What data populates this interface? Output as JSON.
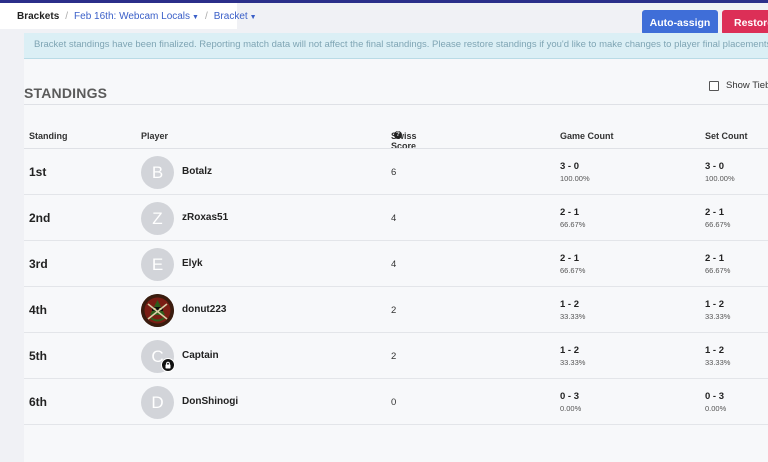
{
  "breadcrumb": {
    "root": "Brackets",
    "event": "Feb 16th: Webcam Locals",
    "view": "Bracket"
  },
  "actions": {
    "auto_assign": "Auto-assign",
    "restore": "Restore"
  },
  "banner": {
    "text": "Bracket standings have been finalized. Reporting match data will not affect the final standings. Please restore standings if you'd like to make changes to player final placements."
  },
  "standings": {
    "title": "STANDINGS",
    "show_tiebreakers_label": "Show Tieb",
    "columns": {
      "standing": "Standing",
      "player": "Player",
      "swiss_score": "Swiss Score",
      "game_count": "Game Count",
      "set_count": "Set Count"
    },
    "rows": [
      {
        "place": "1st",
        "initial": "B",
        "name": "Botalz",
        "swiss": "6",
        "game": "3 - 0",
        "game_pct": "100.00%",
        "set": "3 - 0",
        "set_pct": "100.00%"
      },
      {
        "place": "2nd",
        "initial": "Z",
        "name": "zRoxas51",
        "swiss": "4",
        "game": "2 - 1",
        "game_pct": "66.67%",
        "set": "2 - 1",
        "set_pct": "66.67%"
      },
      {
        "place": "3rd",
        "initial": "E",
        "name": "Elyk",
        "swiss": "4",
        "game": "2 - 1",
        "game_pct": "66.67%",
        "set": "2 - 1",
        "set_pct": "66.67%"
      },
      {
        "place": "4th",
        "initial": "",
        "name": "donut223",
        "swiss": "2",
        "game": "1 - 2",
        "game_pct": "33.33%",
        "set": "1 - 2",
        "set_pct": "33.33%"
      },
      {
        "place": "5th",
        "initial": "C",
        "name": "Captain",
        "swiss": "2",
        "game": "1 - 2",
        "game_pct": "33.33%",
        "set": "1 - 2",
        "set_pct": "33.33%"
      },
      {
        "place": "6th",
        "initial": "D",
        "name": "DonShinogi",
        "swiss": "0",
        "game": "0 - 3",
        "game_pct": "0.00%",
        "set": "0 - 3",
        "set_pct": "0.00%"
      }
    ]
  },
  "icons": {
    "help": "question-circle-icon",
    "caret": "caret-down-icon",
    "checkbox": "checkbox-unchecked",
    "badge": "lock-badge-icon",
    "avatar_image": "masked-character-avatar"
  }
}
